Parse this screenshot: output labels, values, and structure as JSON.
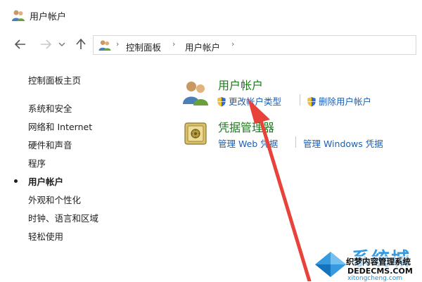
{
  "window": {
    "title": "用户帐户",
    "title_icon": "users-icon"
  },
  "nav": {
    "back_icon": "arrow-left-icon",
    "forward_icon": "arrow-right-icon",
    "recent_icon": "chevron-down-icon",
    "up_icon": "arrow-up-icon"
  },
  "address": {
    "icon": "users-icon",
    "crumbs": [
      "控制面板",
      "用户帐户"
    ]
  },
  "leftnav": {
    "home": "控制面板主页",
    "items": [
      {
        "label": "系统和安全",
        "active": false
      },
      {
        "label": "网络和 Internet",
        "active": false
      },
      {
        "label": "硬件和声音",
        "active": false
      },
      {
        "label": "程序",
        "active": false
      },
      {
        "label": "用户帐户",
        "active": true
      },
      {
        "label": "外观和个性化",
        "active": false
      },
      {
        "label": "时钟、语言和区域",
        "active": false
      },
      {
        "label": "轻松使用",
        "active": false
      }
    ]
  },
  "categories": [
    {
      "title": "用户帐户",
      "icon": "users-icon",
      "links": [
        "更改帐户类型",
        "删除用户帐户"
      ]
    },
    {
      "title": "凭据管理器",
      "icon": "vault-icon",
      "links": [
        "管理 Web 凭据",
        "管理 Windows 凭据"
      ]
    }
  ],
  "watermark": {
    "brand": "系统城",
    "line1": "织梦内容管理系统",
    "line2": "DEDECMS.COM",
    "line3": "xitongcheng.com"
  },
  "colors": {
    "link": "#1a5fb4",
    "category_title": "#1c7a1c",
    "annotation_arrow": "#e8423a"
  }
}
